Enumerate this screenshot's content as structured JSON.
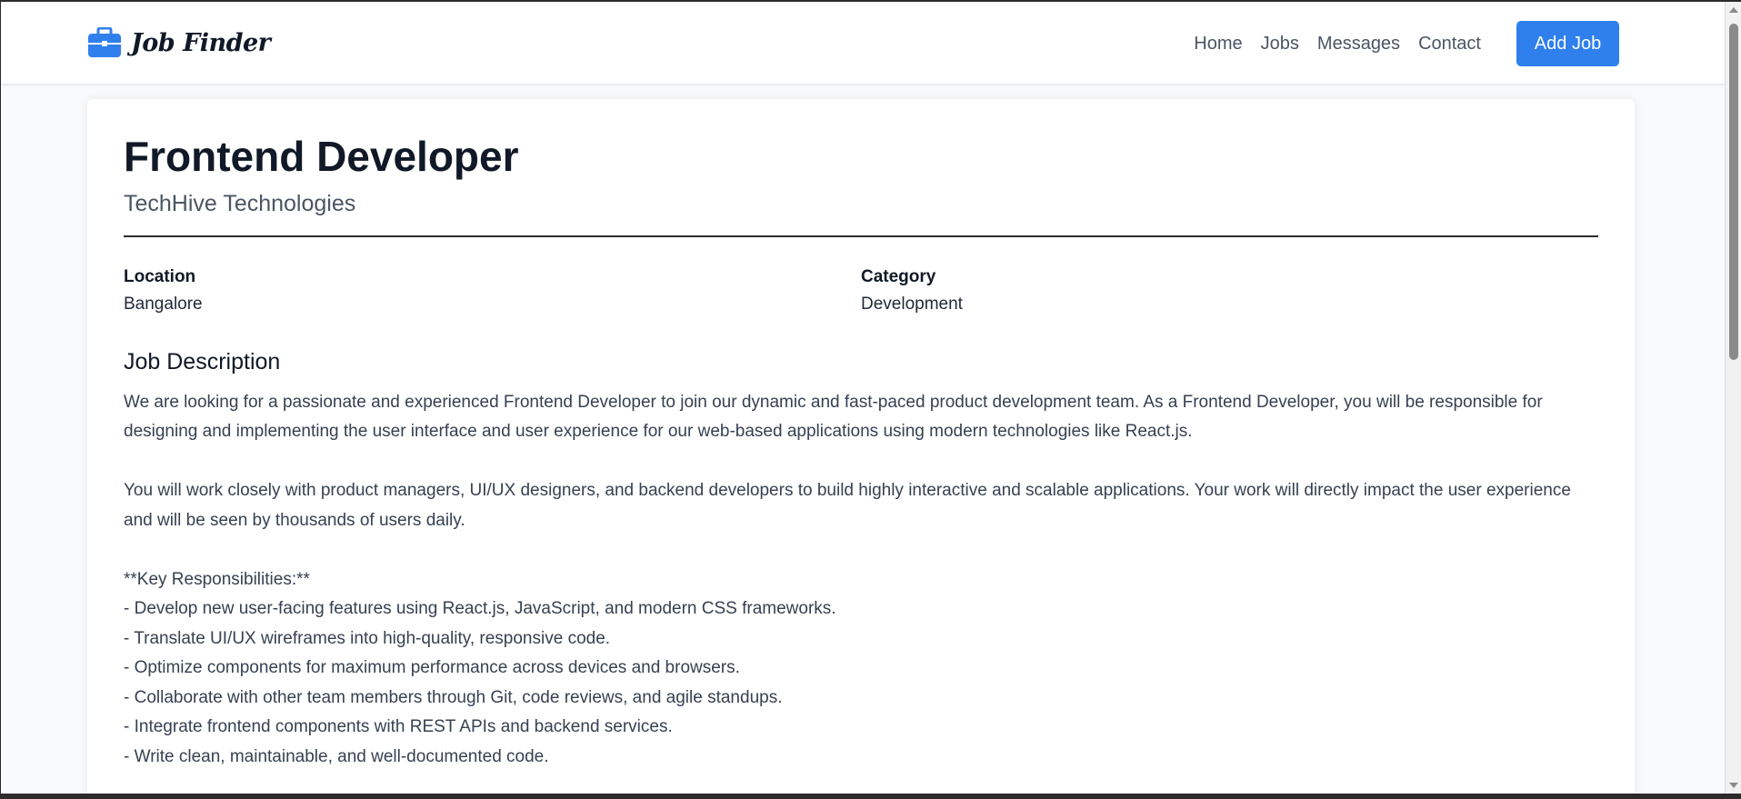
{
  "brand": {
    "name": "Job Finder",
    "icon": "briefcase-icon",
    "icon_color": "#2f80ed"
  },
  "nav": {
    "links": [
      "Home",
      "Jobs",
      "Messages",
      "Contact"
    ],
    "add_job_label": "Add Job",
    "accent_color": "#2f80ed"
  },
  "job": {
    "title": "Frontend Developer",
    "company": "TechHive Technologies",
    "location_label": "Location",
    "location": "Bangalore",
    "category_label": "Category",
    "category": "Development",
    "description_heading": "Job Description",
    "description": "We are looking for a passionate and experienced Frontend Developer to join our dynamic and fast-paced product development team. As a Frontend Developer, you will be responsible for designing and implementing the user interface and user experience for our web-based applications using modern technologies like React.js.\n\nYou will work closely with product managers, UI/UX designers, and backend developers to build highly interactive and scalable applications. Your work will directly impact the user experience and will be seen by thousands of users daily.\n\n**Key Responsibilities:**\n- Develop new user-facing features using React.js, JavaScript, and modern CSS frameworks.\n- Translate UI/UX wireframes into high-quality, responsive code.\n- Optimize components for maximum performance across devices and browsers.\n- Collaborate with other team members through Git, code reviews, and agile standups.\n- Integrate frontend components with REST APIs and backend services.\n- Write clean, maintainable, and well-documented code."
  }
}
